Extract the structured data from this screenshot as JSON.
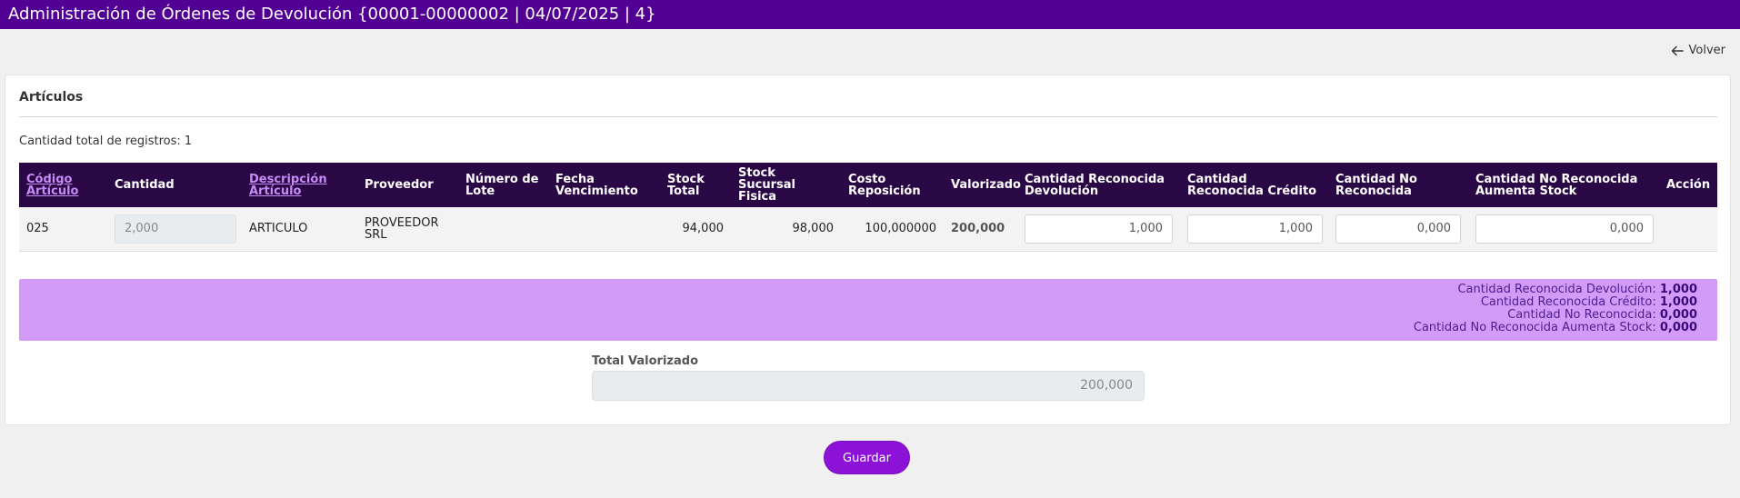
{
  "header": {
    "title": "Administración de Órdenes de Devolución {00001-00000002 | 04/07/2025 | 4}"
  },
  "nav": {
    "back_label": "Volver",
    "back_icon": "arrow-left-icon"
  },
  "section": {
    "title": "Artículos",
    "count_label": "Cantidad total de registros: 1"
  },
  "table": {
    "columns": [
      {
        "key": "codigo",
        "label": "Código Artículo",
        "sortable": true
      },
      {
        "key": "cantidad",
        "label": "Cantidad",
        "sortable": false
      },
      {
        "key": "descripcion",
        "label": "Descripción Artículo",
        "sortable": true
      },
      {
        "key": "proveedor",
        "label": "Proveedor",
        "sortable": false
      },
      {
        "key": "lote",
        "label": "Número de Lote",
        "sortable": false
      },
      {
        "key": "vencimiento",
        "label": "Fecha Vencimiento",
        "sortable": false
      },
      {
        "key": "stock_total",
        "label": "Stock Total",
        "sortable": false
      },
      {
        "key": "stock_sucursal",
        "label": "Stock Sucursal Fisica",
        "sortable": false
      },
      {
        "key": "costo",
        "label": "Costo Reposición",
        "sortable": false
      },
      {
        "key": "valorizado",
        "label": "Valorizado",
        "sortable": false
      },
      {
        "key": "cant_rec_dev",
        "label": "Cantidad Reconocida Devolución",
        "sortable": false
      },
      {
        "key": "cant_rec_cred",
        "label": "Cantidad Reconocida Crédito",
        "sortable": false
      },
      {
        "key": "cant_no_rec",
        "label": "Cantidad No Reconocida",
        "sortable": false
      },
      {
        "key": "cant_no_rec_stock",
        "label": "Cantidad No Reconocida Aumenta Stock",
        "sortable": false
      },
      {
        "key": "accion",
        "label": "Acción",
        "sortable": false
      }
    ],
    "rows": [
      {
        "codigo": "025",
        "cantidad": "2,000",
        "descripcion": "ARTICULO",
        "proveedor": "PROVEEDOR SRL",
        "lote": "",
        "vencimiento": "",
        "stock_total": "94,000",
        "stock_sucursal": "98,000",
        "costo": "100,000000",
        "valorizado": "200,000",
        "cant_rec_dev": "1,000",
        "cant_rec_cred": "1,000",
        "cant_no_rec": "0,000",
        "cant_no_rec_stock": "0,000",
        "accion": ""
      }
    ]
  },
  "summary": {
    "lines": [
      {
        "label": "Cantidad Reconocida Devolución:",
        "value": "1,000"
      },
      {
        "label": "Cantidad Reconocida Crédito:",
        "value": "1,000"
      },
      {
        "label": "Cantidad No Reconocida:",
        "value": "0,000"
      },
      {
        "label": "Cantidad No Reconocida Aumenta Stock:",
        "value": "0,000"
      }
    ]
  },
  "total": {
    "label": "Total Valorizado",
    "value": "200,000"
  },
  "actions": {
    "save_label": "Guardar"
  },
  "colors": {
    "header_bg": "#520094",
    "table_header_bg": "#2a0845",
    "summary_bg": "#d39bf8",
    "button_bg": "#8b12d6",
    "link": "#c68bf5"
  }
}
